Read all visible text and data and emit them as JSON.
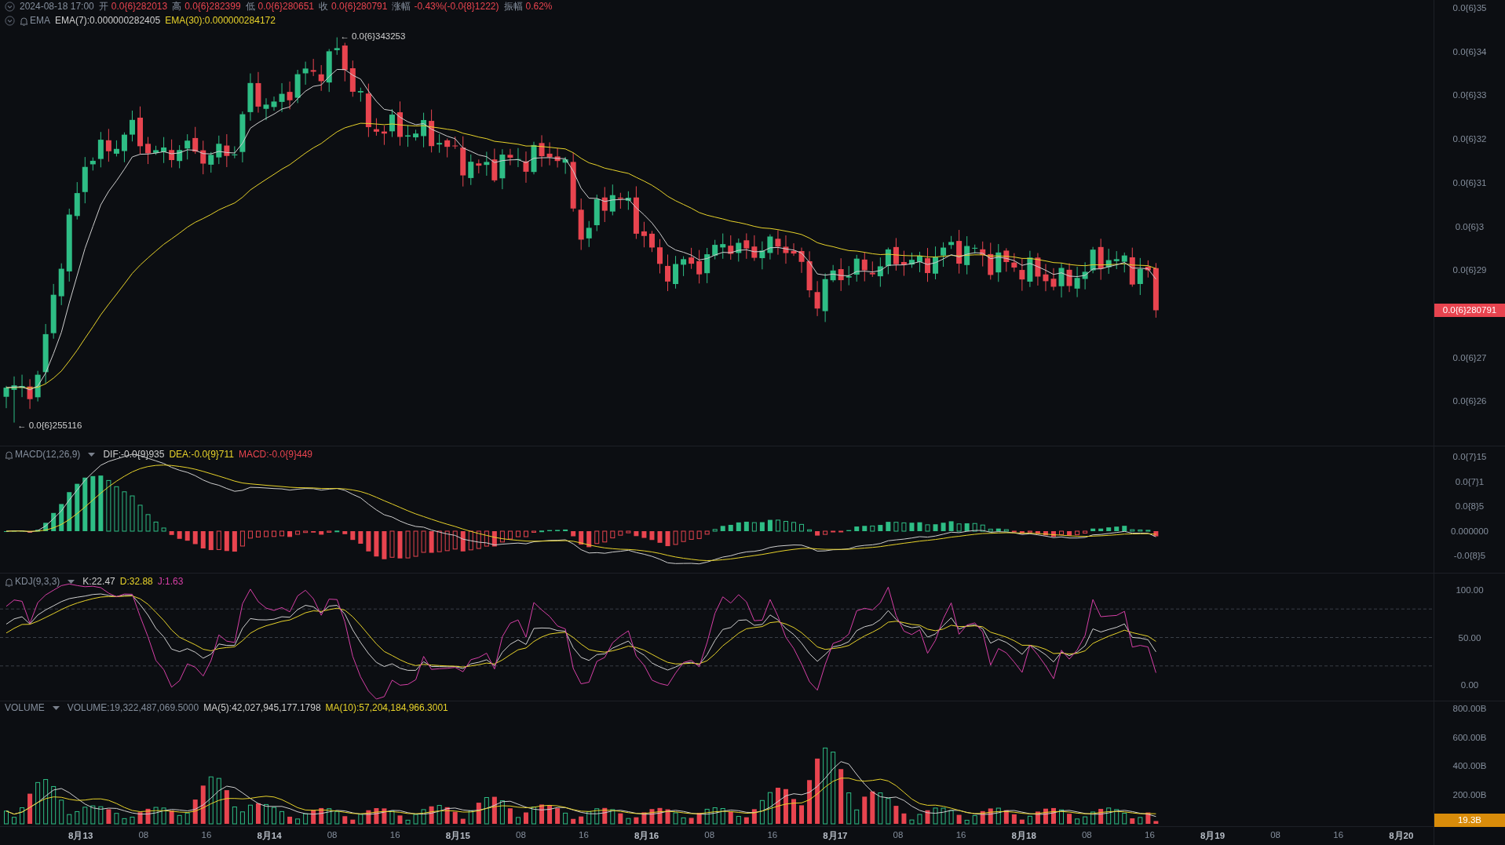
{
  "ohlc_header": {
    "datetime": "2024-08-18 17:00",
    "fields": [
      {
        "label": "开",
        "value": "0.0{6}282013"
      },
      {
        "label": "高",
        "value": "0.0{6}282399"
      },
      {
        "label": "低",
        "value": "0.0{6}280651"
      },
      {
        "label": "收",
        "value": "0.0{6}280791"
      },
      {
        "label": "涨幅",
        "value": "-0.43%(-0.0{8}1222)"
      },
      {
        "label": "振幅",
        "value": "0.62%"
      }
    ]
  },
  "main_pane": {
    "legend": {
      "name": "EMA",
      "bell": true,
      "dropdown": false,
      "readouts": [
        {
          "text": "EMA(7):0.000000282405",
          "color": "#cfcfcf"
        },
        {
          "text": "EMA(30):0.000000284172",
          "color": "#e8d32a"
        }
      ]
    },
    "high_marker": "← 0.0{6}343253",
    "low_marker": "← 0.0{6}255116",
    "y_labels": [
      "0.0{6}35",
      "0.0{6}34",
      "0.0{6}33",
      "0.0{6}32",
      "0.0{6}31",
      "0.0{6}3",
      "0.0{6}29",
      "0.0{6}27",
      "0.0{6}26"
    ],
    "price_tag": "0.0{6}280791"
  },
  "macd_pane": {
    "legend": {
      "name": "MACD(12,26,9)",
      "bell": true,
      "dropdown": true,
      "readouts": [
        {
          "text": "DIF:-0.0{9}935",
          "color": "#cfcfcf"
        },
        {
          "text": "DEA:-0.0{9}711",
          "color": "#e8d32a"
        },
        {
          "text": "MACD:-0.0{9}449",
          "color": "#e8444f"
        }
      ]
    },
    "y_labels": [
      "0.0{7}15",
      "0.0{7}1",
      "0.0{8}5",
      "0.000000",
      "-0.0{8}5"
    ]
  },
  "kdj_pane": {
    "legend": {
      "name": "KDJ(9,3,3)",
      "bell": true,
      "dropdown": true,
      "readouts": [
        {
          "text": "K:22.47",
          "color": "#cfcfcf"
        },
        {
          "text": "D:32.88",
          "color": "#e8d32a"
        },
        {
          "text": "J:1.63",
          "color": "#d63fa6"
        }
      ]
    },
    "y_labels": [
      "100.00",
      "50.00",
      "0.00"
    ]
  },
  "volume_pane": {
    "legend": {
      "name": "VOLUME",
      "bell": false,
      "dropdown": true,
      "readouts": [
        {
          "text": "VOLUME:19,322,487,069.5000",
          "color": "#848e9c"
        },
        {
          "text": "MA(5):42,027,945,177.1798",
          "color": "#cfcfcf"
        },
        {
          "text": "MA(10):57,204,184,966.3001",
          "color": "#e8d32a"
        }
      ]
    },
    "y_labels": [
      "800.00B",
      "600.00B",
      "400.00B",
      "200.00B"
    ],
    "value_tag": "19.3B"
  },
  "x_axis": {
    "labels": [
      {
        "text": "8月13",
        "kind": "day"
      },
      {
        "text": "08",
        "kind": "hour"
      },
      {
        "text": "16",
        "kind": "hour"
      },
      {
        "text": "8月14",
        "kind": "day"
      },
      {
        "text": "08",
        "kind": "hour"
      },
      {
        "text": "16",
        "kind": "hour"
      },
      {
        "text": "8月15",
        "kind": "day"
      },
      {
        "text": "08",
        "kind": "hour"
      },
      {
        "text": "16",
        "kind": "hour"
      },
      {
        "text": "8月16",
        "kind": "day"
      },
      {
        "text": "08",
        "kind": "hour"
      },
      {
        "text": "16",
        "kind": "hour"
      },
      {
        "text": "8月17",
        "kind": "day"
      },
      {
        "text": "08",
        "kind": "hour"
      },
      {
        "text": "16",
        "kind": "hour"
      },
      {
        "text": "8月18",
        "kind": "day"
      },
      {
        "text": "08",
        "kind": "hour"
      },
      {
        "text": "16",
        "kind": "hour"
      },
      {
        "text": "8月19",
        "kind": "day"
      },
      {
        "text": "08",
        "kind": "hour"
      },
      {
        "text": "16",
        "kind": "hour"
      },
      {
        "text": "8月20",
        "kind": "day"
      }
    ]
  }
}
